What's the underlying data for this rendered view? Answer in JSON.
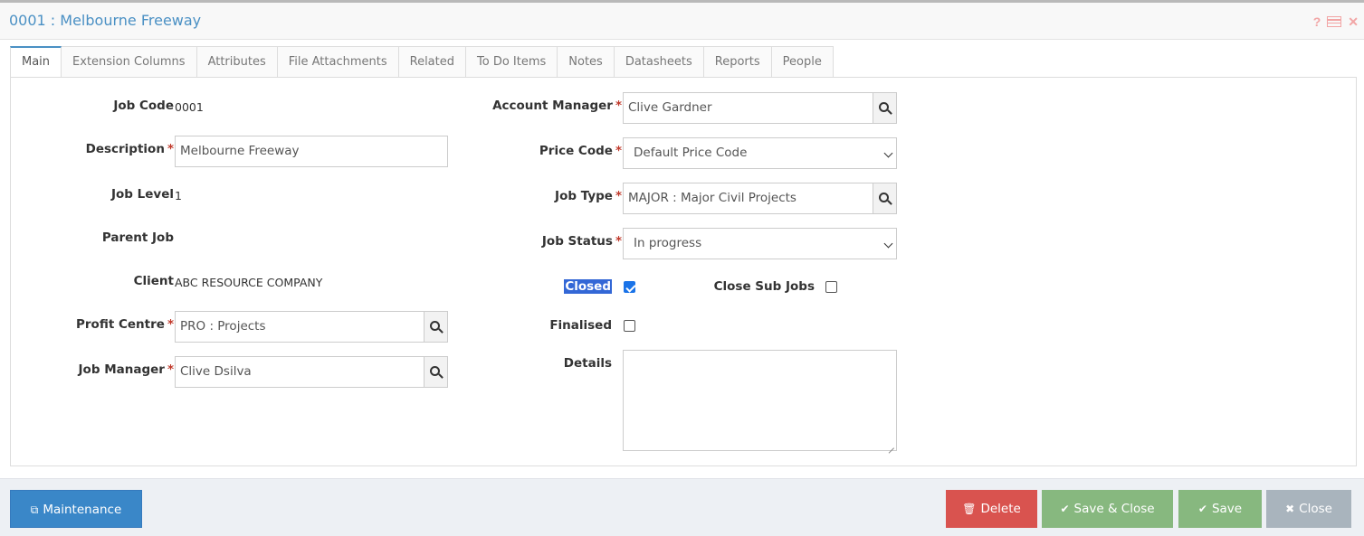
{
  "window": {
    "title": "0001 : Melbourne Freeway",
    "icons": [
      "help-icon",
      "table-icon",
      "close-icon"
    ],
    "help_glyph": "?",
    "close_glyph": "✕"
  },
  "tabs": [
    {
      "label": "Main",
      "active": true
    },
    {
      "label": "Extension Columns"
    },
    {
      "label": "Attributes"
    },
    {
      "label": "File Attachments"
    },
    {
      "label": "Related"
    },
    {
      "label": "To Do Items"
    },
    {
      "label": "Notes"
    },
    {
      "label": "Datasheets"
    },
    {
      "label": "Reports"
    },
    {
      "label": "People"
    }
  ],
  "form": {
    "job_code": {
      "label": "Job Code",
      "value": "0001"
    },
    "description": {
      "label": "Description",
      "value": "Melbourne Freeway",
      "required": true
    },
    "job_level": {
      "label": "Job Level",
      "value": "1"
    },
    "parent_job": {
      "label": "Parent Job",
      "value": ""
    },
    "client": {
      "label": "Client",
      "value": "ABC RESOURCE COMPANY"
    },
    "profit_centre": {
      "label": "Profit Centre",
      "value": "PRO : Projects",
      "required": true
    },
    "job_manager": {
      "label": "Job Manager",
      "value": "Clive Dsilva",
      "required": true
    },
    "account_manager": {
      "label": "Account Manager",
      "value": "Clive Gardner",
      "required": true
    },
    "price_code": {
      "label": "Price Code",
      "value": "Default Price Code",
      "required": true
    },
    "job_type": {
      "label": "Job Type",
      "value": "MAJOR : Major Civil Projects",
      "required": true
    },
    "job_status": {
      "label": "Job Status",
      "value": "In progress",
      "required": true
    },
    "closed": {
      "label": "Closed",
      "checked": true
    },
    "close_sub_jobs": {
      "label": "Close Sub Jobs",
      "checked": false
    },
    "finalised": {
      "label": "Finalised",
      "checked": false
    },
    "details": {
      "label": "Details",
      "value": ""
    },
    "required_marker": "*"
  },
  "footer": {
    "maintenance": "Maintenance",
    "delete": "Delete",
    "save_close": "Save & Close",
    "save": "Save",
    "close": "Close"
  },
  "colors": {
    "title": "#4a90c4",
    "required": "#c0392b",
    "maintenance": "#3a87c8",
    "delete": "#d9534f",
    "save": "#87b87f",
    "close": "#a9b4bd"
  }
}
